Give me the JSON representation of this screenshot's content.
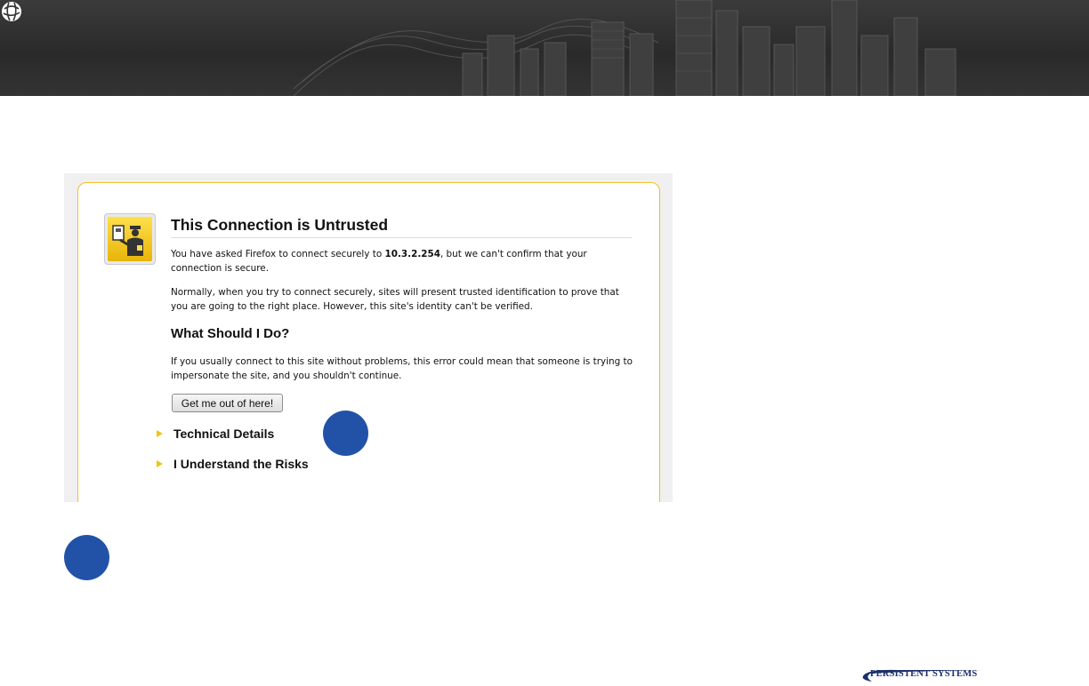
{
  "banner": {
    "logo_icon": "globe-icon"
  },
  "dialog": {
    "icon": "police-officer-certificate-icon",
    "title": "This Connection is Untrusted",
    "para1_prefix": "You have asked Firefox to connect securely to ",
    "para1_host": "10.3.2.254",
    "para1_suffix": ", but we can't confirm that your connection is secure.",
    "para2": "Normally, when you try to connect securely, sites will present trusted identification to prove that you are going to the right place. However, this site's identity can't be verified.",
    "subheading": "What Should I Do?",
    "para3": "If you usually connect to this site without problems, this error could mean that someone is trying to impersonate the site, and you shouldn't continue.",
    "escape_button": "Get me out of here!",
    "expanders": [
      {
        "label": "Technical Details"
      },
      {
        "label": "I Understand the Risks"
      }
    ]
  },
  "footer": {
    "brand": "PERSISTENT SYSTEMS"
  },
  "colors": {
    "banner": "#2f2f2f",
    "card_border": "#f0c02a",
    "marker": "#2252a8",
    "expander_arrow": "#f2c40c",
    "brand": "#1b2f6b"
  }
}
